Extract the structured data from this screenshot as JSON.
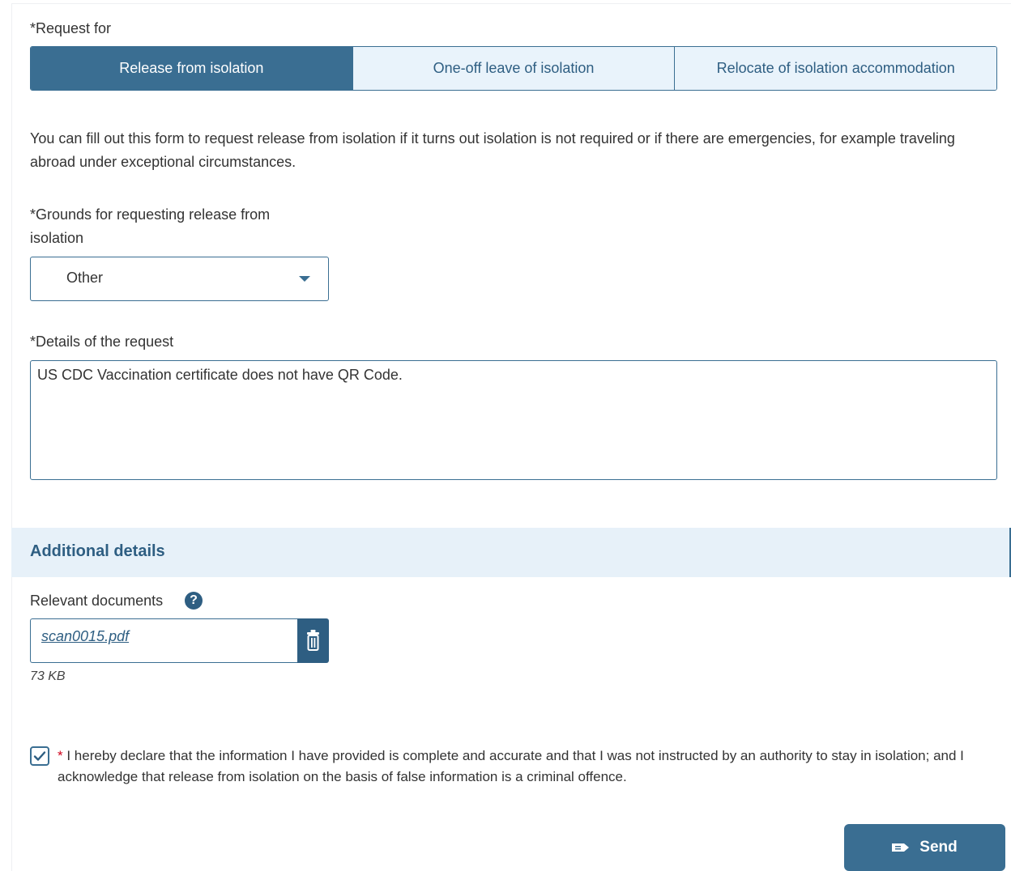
{
  "request_for": {
    "label": "*Request for",
    "options": [
      "Release from isolation",
      "One-off leave of isolation",
      "Relocate of isolation accommodation"
    ],
    "selected_index": 0
  },
  "description": "You can fill out this form to request release from isolation if it turns out isolation is not required or if there are emergencies, for example traveling abroad under exceptional circumstances.",
  "grounds": {
    "label_line1": "*Grounds for requesting release from",
    "label_line2": "isolation",
    "selected_value": "Other"
  },
  "details": {
    "label": "*Details of the request",
    "value": "US CDC Vaccination certificate does not have QR Code."
  },
  "additional": {
    "section_title": "Additional details",
    "documents_label": "Relevant documents",
    "help_glyph": "?",
    "file_name": "scan0015.pdf",
    "file_size": "73 KB"
  },
  "declaration": {
    "required_mark": "*",
    "text": " I hereby declare that the information I have provided is complete and accurate and that I was not instructed by an authority to stay in isolation; and I acknowledge that release from isolation on the basis of false information is a criminal offence.",
    "checked": true
  },
  "send_label": "Send",
  "colors": {
    "primary": "#3a6e92",
    "segment_bg": "#e9f3fb",
    "section_bg": "#e7f1f9",
    "required": "#d0021b"
  }
}
